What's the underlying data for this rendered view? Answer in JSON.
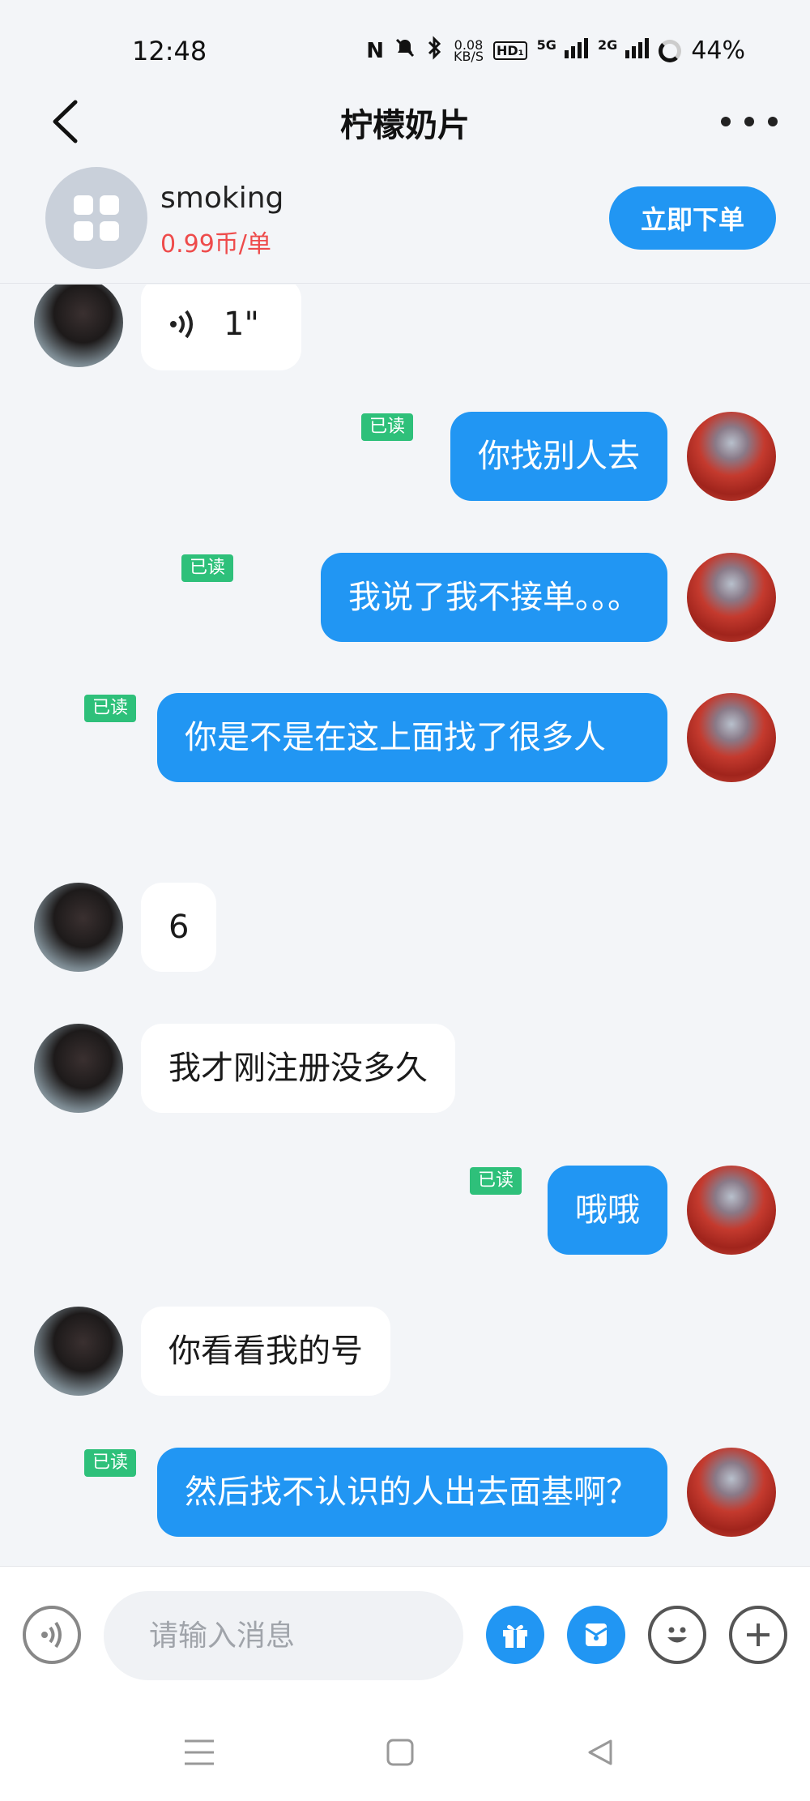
{
  "status_bar": {
    "time": "12:48",
    "nfc": "N",
    "speed_value": "0.08",
    "speed_unit": "KB/S",
    "hd": "HD₁",
    "signal_1": "5G",
    "signal_2": "2G",
    "battery": "44%"
  },
  "header": {
    "title": "柠檬奶片"
  },
  "product": {
    "name": "smoking",
    "price": "0.99币/单",
    "order_button": "立即下单"
  },
  "colors": {
    "accent": "#2196f3",
    "read_badge": "#2ec07a",
    "price": "#ee4b4b"
  },
  "messages": [
    {
      "side": "left",
      "type": "voice",
      "text": "1\""
    },
    {
      "side": "right",
      "read": "已读",
      "text": "你找别人去"
    },
    {
      "side": "right",
      "read": "已读",
      "text": "我说了我不接单。。。"
    },
    {
      "side": "right",
      "read": "已读",
      "text": "你是不是在这上面找了很多人"
    },
    {
      "side": "left",
      "text": "6"
    },
    {
      "side": "left",
      "text": "我才刚注册没多久"
    },
    {
      "side": "right",
      "read": "已读",
      "text": "哦哦"
    },
    {
      "side": "left",
      "text": "你看看我的号"
    },
    {
      "side": "right",
      "read": "已读",
      "text": "然后找不认识的人出去面基啊？"
    }
  ],
  "input": {
    "placeholder": "请输入消息"
  },
  "icons": {
    "back": "chevron-left-icon",
    "more": "more-dots-icon",
    "voice": "voice-icon",
    "gift": "gift-icon",
    "coupon": "coupon-icon",
    "emoji": "emoji-icon",
    "plus": "plus-icon"
  }
}
